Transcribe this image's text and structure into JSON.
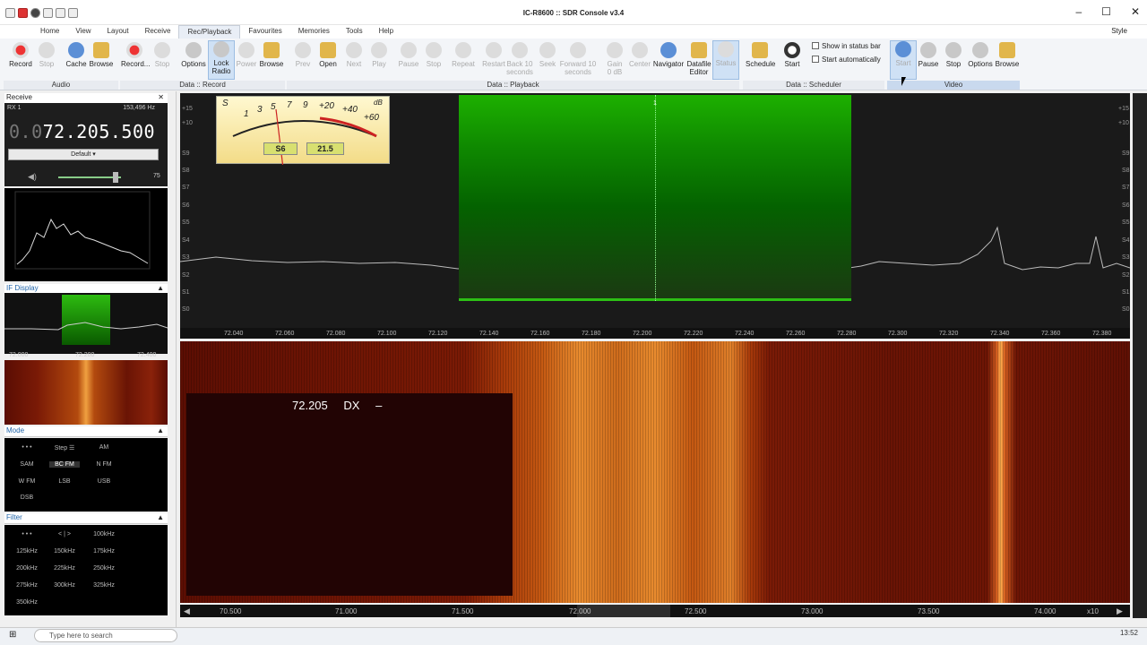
{
  "window": {
    "title": "IC-R8600 :: SDR Console v3.4",
    "style_label": "Style"
  },
  "tabs": [
    "Home",
    "View",
    "Layout",
    "Receive",
    "Rec/Playback",
    "Favourites",
    "Memories",
    "Tools",
    "Help"
  ],
  "ribbon": {
    "audio": {
      "group": "Audio",
      "record": "Record",
      "stop": "Stop",
      "cache": "Cache",
      "browse": "Browse"
    },
    "data_record": {
      "group": "Data :: Record",
      "record": "Record...",
      "stop": "Stop",
      "options": "Options",
      "lock_radio": "Lock Radio",
      "power": "Power",
      "browse": "Browse"
    },
    "data_playback": {
      "group": "Data :: Playback",
      "prev": "Prev",
      "open": "Open",
      "next": "Next",
      "play": "Play",
      "pause": "Pause",
      "stop": "Stop",
      "repeat": "Repeat",
      "restart": "Restart",
      "back10": "Back 10 seconds",
      "seek": "Seek",
      "fwd10": "Forward 10 seconds",
      "gain": "Gain",
      "gain_value": "0 dB",
      "center": "Center",
      "navigator": "Navigator",
      "datafile_editor": "Datafile Editor",
      "status": "Status"
    },
    "data_scheduler": {
      "group": "Data :: Scheduler",
      "schedule": "Schedule",
      "start": "Start",
      "show_in_status_bar": "Show in status bar",
      "start_automatically": "Start automatically"
    },
    "video": {
      "group": "Video",
      "start": "Start",
      "pause": "Pause",
      "stop": "Stop",
      "options": "Options",
      "browse": "Browse"
    }
  },
  "left_panel": {
    "receive_header": "Receive",
    "rx_label": "RX 1",
    "rx_hz": "153,496 Hz",
    "freq_dim": "0.0",
    "freq_main": "72.205.500",
    "profile": "Default",
    "volume": "75",
    "volume_level": 0.75,
    "if_display_header": "IF Display",
    "if_ticks": [
      "72.000",
      "72.200",
      "72.400"
    ],
    "mode_header": "Mode",
    "mode_buttons": [
      "• • •",
      "Step ☰",
      "AM",
      "SAM",
      "BC FM",
      "N FM",
      "W FM",
      "LSB",
      "USB",
      "DSB"
    ],
    "filter_header": "Filter",
    "filter_buttons": [
      "• • •",
      "< | >",
      "100kHz",
      "125kHz",
      "150kHz",
      "175kHz",
      "200kHz",
      "225kHz",
      "250kHz",
      "275kHz",
      "300kHz",
      "325kHz",
      "350kHz"
    ]
  },
  "meter": {
    "s_label": "S",
    "db_label": "dB",
    "scale": [
      "1",
      "3",
      "5",
      "7",
      "9",
      "+20",
      "+40",
      "+60"
    ],
    "s_value": "S6",
    "db_value": "21.5"
  },
  "spectrum": {
    "marker": "1",
    "db_left": [
      "+15",
      "+10",
      "S9",
      "S8",
      "S7",
      "S6",
      "S5",
      "S4",
      "S3",
      "S2",
      "S1",
      "S0"
    ],
    "db_right": [
      "+15",
      "+10",
      "S9",
      "S8",
      "S7",
      "S6",
      "S5",
      "S4",
      "S3",
      "S2",
      "S1",
      "S0"
    ],
    "x_ticks": [
      "72.040",
      "72.060",
      "72.080",
      "72.100",
      "72.120",
      "72.140",
      "72.160",
      "72.180",
      "72.200",
      "72.220",
      "72.240",
      "72.260",
      "72.280",
      "72.300",
      "72.320",
      "72.340",
      "72.360",
      "72.380"
    ]
  },
  "waterfall": {
    "overlay_freq": "72.205",
    "overlay_label": "DX",
    "overlay_dash": "–"
  },
  "bottom_axis": {
    "ticks": [
      "70.500",
      "71.000",
      "71.500",
      "72.000",
      "72.500",
      "73.000",
      "73.500",
      "74.000"
    ],
    "zoom": "x10"
  },
  "taskbar": {
    "search_placeholder": "Type here to search",
    "time": "13:52"
  }
}
